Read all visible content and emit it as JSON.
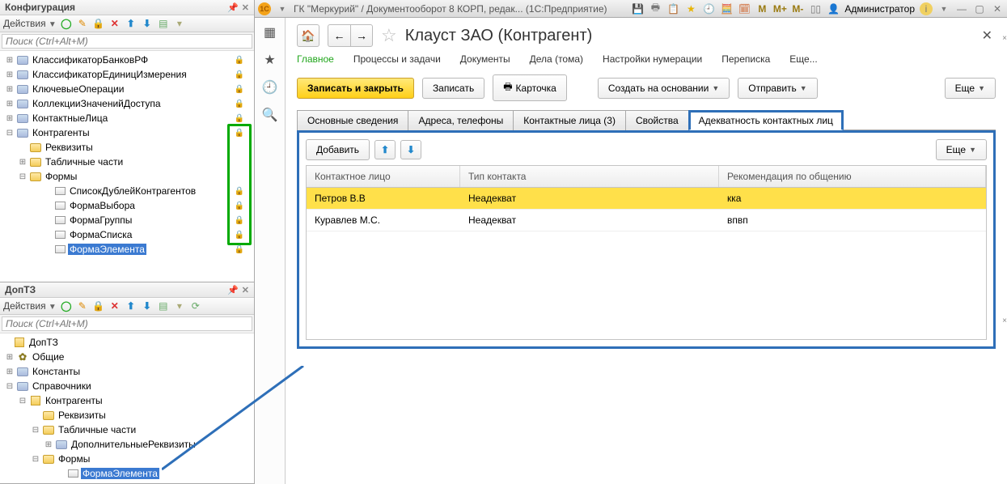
{
  "left": {
    "config_title": "Конфигурация",
    "doptz_title": "ДопТЗ",
    "actions_label": "Действия",
    "search_placeholder": "Поиск (Ctrl+Alt+M)",
    "cfg_tree": {
      "n1": "КлассификаторБанковРФ",
      "n2": "КлассификаторЕдиницИзмерения",
      "n3": "КлючевыеОперации",
      "n4": "КоллекцииЗначенийДоступа",
      "n5": "КонтактныеЛица",
      "n6": "Контрагенты",
      "n6a": "Реквизиты",
      "n6b": "Табличные части",
      "n6c": "Формы",
      "f1": "СписокДублейКонтрагентов",
      "f2": "ФормаВыбора",
      "f3": "ФормаГруппы",
      "f4": "ФормаСписка",
      "f5": "ФормаЭлемента"
    },
    "dop_tree": {
      "r": "ДопТЗ",
      "c1": "Общие",
      "c2": "Константы",
      "c3": "Справочники",
      "k": "Контрагенты",
      "k1": "Реквизиты",
      "k2": "Табличные части",
      "k2a": "ДополнительныеРеквизиты",
      "k3": "Формы",
      "k3a": "ФормаЭлемента"
    }
  },
  "top": {
    "title": "ГК \"Меркурий\" / Документооборот 8 КОРП, редак...  (1С:Предприятие)",
    "m1": "M",
    "m2": "M+",
    "m3": "M-",
    "user": "Администратор"
  },
  "main": {
    "title": "Клауст ЗАО (Контрагент)",
    "nav": {
      "t1": "Главное",
      "t2": "Процессы и задачи",
      "t3": "Документы",
      "t4": "Дела (тома)",
      "t5": "Настройки нумерации",
      "t6": "Переписка",
      "t7": "Еще..."
    },
    "cmd": {
      "save_close": "Записать и закрыть",
      "save": "Записать",
      "card": "Карточка",
      "create": "Создать на основании",
      "send": "Отправить",
      "more": "Еще"
    },
    "tabs": {
      "t1": "Основные сведения",
      "t2": "Адреса, телефоны",
      "t3": "Контактные лица (3)",
      "t4": "Свойства",
      "t5": "Адекватность контактных лиц"
    },
    "sub": {
      "add": "Добавить",
      "more": "Еще"
    },
    "grid": {
      "h1": "Контактное лицо",
      "h2": "Тип контакта",
      "h3": "Рекомендация по общению",
      "r1c1": "Петров В.В",
      "r1c2": "Неадекват",
      "r1c3": "кка",
      "r2c1": "Куравлев М.С.",
      "r2c2": "Неадекват",
      "r2c3": "впвп"
    }
  }
}
